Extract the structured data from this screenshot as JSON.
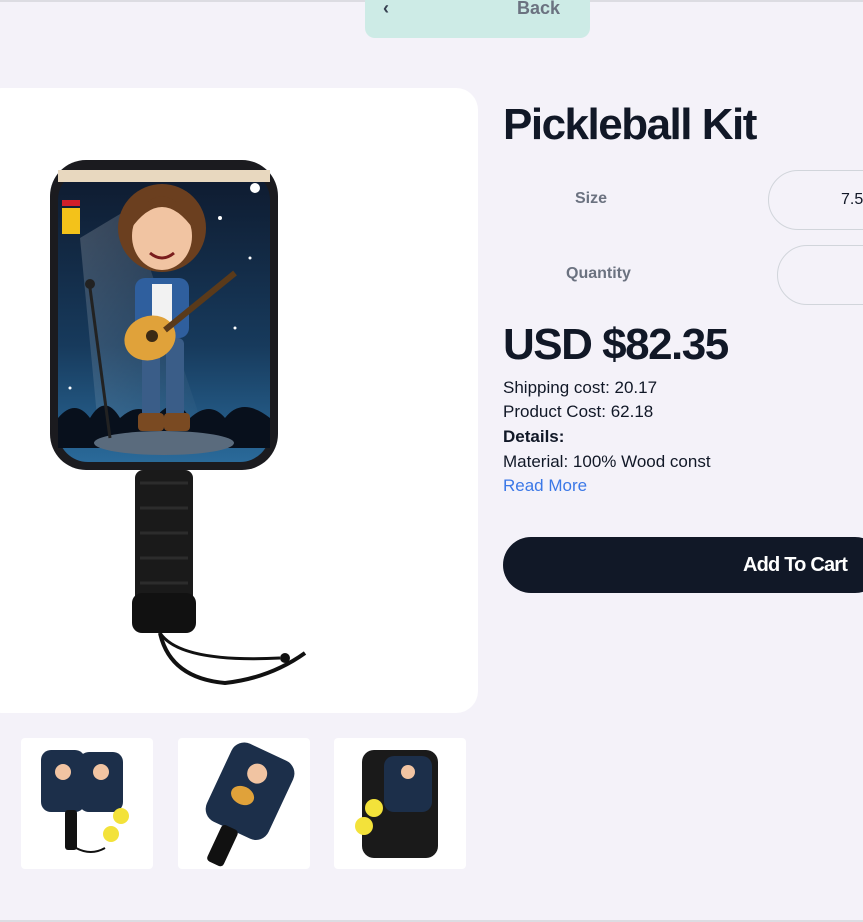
{
  "nav": {
    "back_label": "Back"
  },
  "product": {
    "title": "Pickleball Kit",
    "size_label": "Size",
    "size_value": "7.5",
    "quantity_label": "Quantity",
    "quantity_value": "",
    "price": "USD $82.35",
    "shipping": "Shipping cost: 20.17",
    "product_cost": "Product Cost: 62.18",
    "details_heading": "Details:",
    "material": "Material: 100% Wood const",
    "read_more": "Read More",
    "add_to_cart": "Add To Cart"
  },
  "colors": {
    "page_bg": "#f4f2f9",
    "back_button_bg": "#cdebe6",
    "primary_dark": "#111827",
    "link_blue": "#3b78e7"
  },
  "images": {
    "main": "paddle-guitar-girl-image",
    "thumbnails": [
      "two-paddles-with-balls-thumbnail",
      "angled-paddle-thumbnail",
      "paddle-case-kit-thumbnail"
    ]
  }
}
